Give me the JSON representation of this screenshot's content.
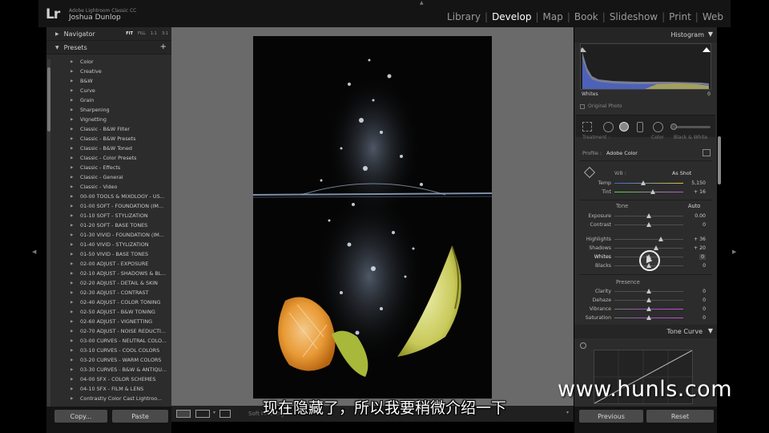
{
  "app": {
    "logo": "Lr",
    "name": "Adobe Lightroom Classic CC",
    "user": "Joshua Dunlop"
  },
  "modules": [
    "Library",
    "Develop",
    "Map",
    "Book",
    "Slideshow",
    "Print",
    "Web"
  ],
  "active_module": "Develop",
  "left_panel": {
    "navigator": {
      "title": "Navigator",
      "options": [
        "FIT",
        "FILL",
        "1:1",
        "3:1"
      ],
      "selected": "FIT"
    },
    "presets": {
      "title": "Presets",
      "add": "+",
      "items": [
        "Color",
        "Creative",
        "B&W",
        "Curve",
        "Grain",
        "Sharpening",
        "Vignetting",
        "Classic - B&W Filter",
        "Classic - B&W Presets",
        "Classic - B&W Toned",
        "Classic - Color Presets",
        "Classic - Effects",
        "Classic - General",
        "Classic - Video",
        "00-00 TOOLS & MIXOLOGY - US...",
        "01-00 SOFT - FOUNDATION (IM...",
        "01-10 SOFT - STYLIZATION",
        "01-20 SOFT - BASE TONES",
        "01-30 VIVID - FOUNDATION (IM...",
        "01-40 VIVID - STYLIZATION",
        "01-50 VIVID - BASE TONES",
        "02-00 ADJUST - EXPOSURE",
        "02-10 ADJUST - SHADOWS & BL...",
        "02-20 ADJUST - DETAIL & SKIN",
        "02-30 ADJUST - CONTRAST",
        "02-40 ADJUST - COLOR TONING",
        "02-50 ADJUST - B&W TONING",
        "02-60 ADJUST - VIGNETTING",
        "02-70 ADJUST - NOISE REDUCTI...",
        "03-00 CURVES - NEUTRAL COLO...",
        "03-10 CURVES - COOL COLORS",
        "03-20 CURVES - WARM COLORS",
        "03-30 CURVES - B&W & ANTIQU...",
        "04-00 SFX - COLOR SCHEMES",
        "04-10 SFX - FILM & LENS",
        "Contrastly Color Cast Lightroo..."
      ]
    },
    "copy_label": "Copy...",
    "paste_label": "Paste"
  },
  "toolbar": {
    "soft_proofing": "Soft Proofing"
  },
  "right_panel": {
    "histogram": {
      "title": "Histogram",
      "readout_label": "Whites",
      "readout_value": "0",
      "original_photo": "Original Photo"
    },
    "basic": {
      "treatment_label": "Treatment :",
      "treatment_color": "Color",
      "treatment_bw": "Black & White",
      "profile_label": "Profile :",
      "profile_value": "Adobe Color",
      "wb_label": "WB :",
      "wb_value": "As Shot",
      "temp": {
        "label": "Temp",
        "value": "5,150",
        "pos": 0.42
      },
      "tint": {
        "label": "Tint",
        "value": "+ 16",
        "pos": 0.56
      },
      "tone_title": "Tone",
      "auto": "Auto",
      "exposure": {
        "label": "Exposure",
        "value": "0.00",
        "pos": 0.5
      },
      "contrast": {
        "label": "Contrast",
        "value": "0",
        "pos": 0.5
      },
      "highlights": {
        "label": "Highlights",
        "value": "+ 36",
        "pos": 0.68
      },
      "shadows": {
        "label": "Shadows",
        "value": "+ 20",
        "pos": 0.6
      },
      "whites": {
        "label": "Whites",
        "value": "0",
        "pos": 0.5
      },
      "blacks": {
        "label": "Blacks",
        "value": "0",
        "pos": 0.5
      },
      "presence_title": "Presence",
      "clarity": {
        "label": "Clarity",
        "value": "0",
        "pos": 0.5
      },
      "dehaze": {
        "label": "Dehaze",
        "value": "0",
        "pos": 0.5
      },
      "vibrance": {
        "label": "Vibrance",
        "value": "0",
        "pos": 0.5
      },
      "saturation": {
        "label": "Saturation",
        "value": "0",
        "pos": 0.5
      }
    },
    "tone_curve": {
      "title": "Tone Curve"
    },
    "previous_label": "Previous",
    "reset_label": "Reset"
  },
  "subtitle": "现在隐藏了，所以我要稍微介绍一下",
  "watermark": "www.hunls.com",
  "colors": {
    "accent_temp_from": "#3a6bd8",
    "accent_temp_to": "#d8c63a",
    "accent_tint_from": "#4bd84a",
    "accent_tint_to": "#c84bd8"
  }
}
